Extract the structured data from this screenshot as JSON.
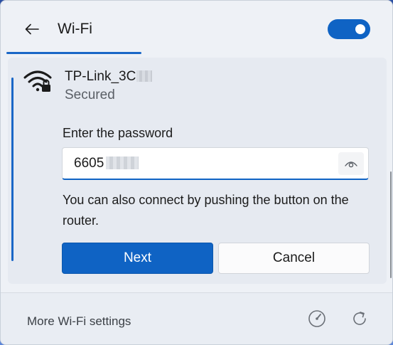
{
  "header": {
    "title": "Wi-Fi",
    "wifi_enabled": true,
    "back_icon": "arrow-left-icon"
  },
  "network": {
    "ssid": "TP-Link_3C",
    "status": "Secured",
    "icon": "wifi-lock-icon"
  },
  "password": {
    "label": "Enter the password",
    "value": "6605",
    "reveal_icon": "eye-icon"
  },
  "hint": "You can also connect by pushing the button on the router.",
  "buttons": {
    "next": "Next",
    "cancel": "Cancel"
  },
  "footer": {
    "settings_link": "More Wi-Fi settings",
    "icons": [
      "speedometer-icon",
      "refresh-icon"
    ]
  },
  "colors": {
    "accent": "#0f63c4",
    "panel": "#eef1f6"
  }
}
